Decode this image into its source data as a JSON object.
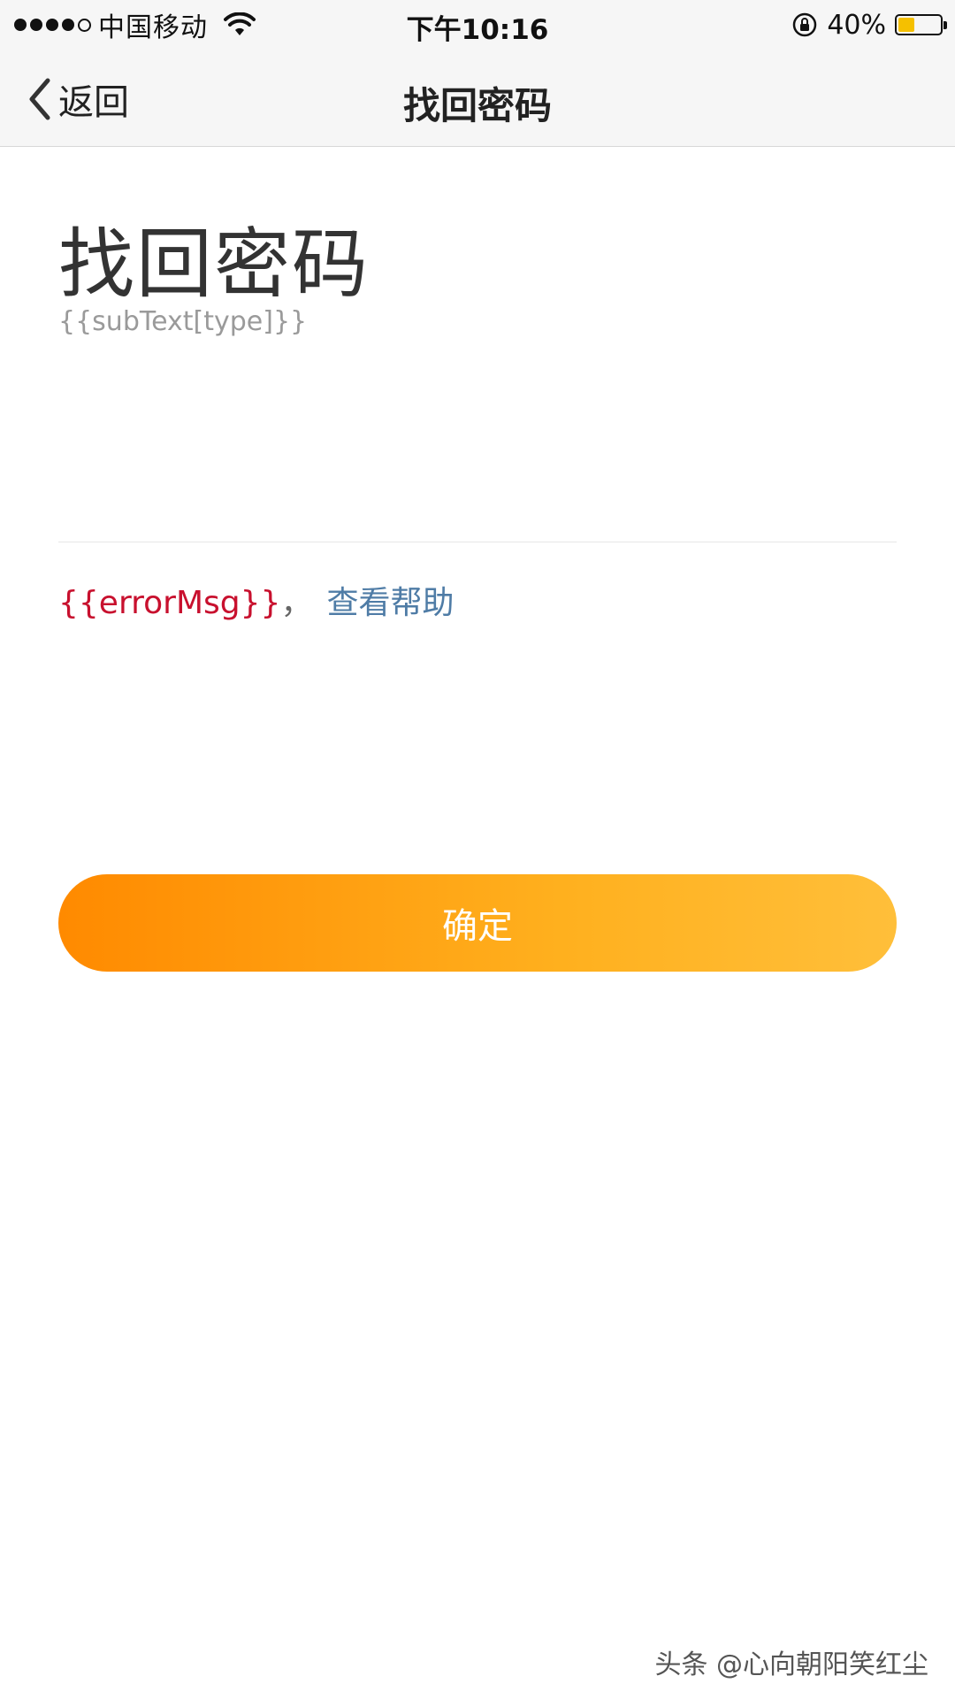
{
  "status_bar": {
    "carrier": "中国移动",
    "time": "下午10:16",
    "battery_percent": "40%",
    "battery_level": 0.4,
    "signal_icon": "signal-dots-icon",
    "wifi_icon": "wifi-icon",
    "rotation_lock_icon": "rotation-lock-icon",
    "battery_icon": "battery-icon"
  },
  "navbar": {
    "back_label": "返回",
    "back_icon": "chevron-left-icon",
    "title": "找回密码"
  },
  "main": {
    "heading": "找回密码",
    "subtext": "{{subText[type]}}",
    "error_msg": "{{errorMsg}}",
    "error_separator": "，",
    "help_link": "查看帮助",
    "confirm_label": "确定"
  },
  "colors": {
    "accent_start": "#ff8a00",
    "accent_end": "#ffbf3a",
    "error": "#c8102e",
    "link": "#4f7ca6"
  },
  "watermark": "头条 @心向朝阳笑红尘"
}
